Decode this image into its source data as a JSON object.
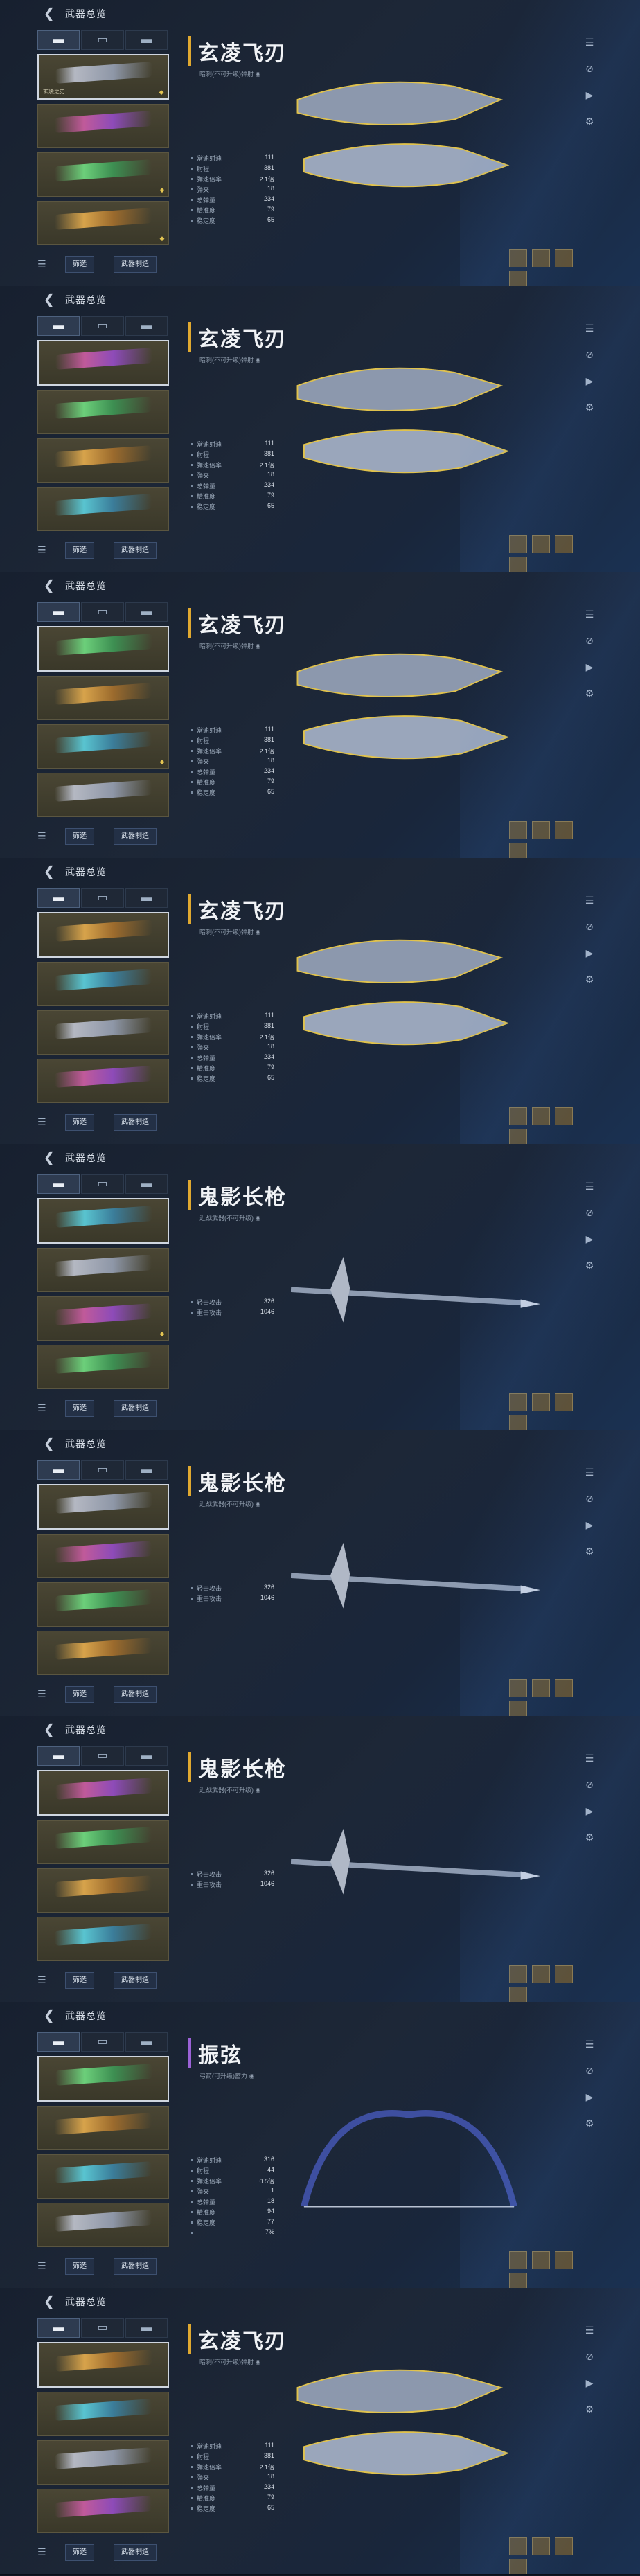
{
  "shared": {
    "nav_title": "武器总览",
    "filter_label": "筛选",
    "custom_label": "武器制造",
    "back_icon": "back-arrow-icon",
    "tool_icons": [
      "list-icon",
      "target-icon",
      "play-icon",
      "gear-icon"
    ]
  },
  "panels": [
    {
      "title": "玄凌飞刃",
      "subtitle": "暗刺(不可升级)弹射 ◉",
      "title_color": "#e0a930",
      "stats": [
        {
          "k": "常速射速",
          "v": "111"
        },
        {
          "k": "射程",
          "v": "381"
        },
        {
          "k": "弹速倍率",
          "v": "2.1倍"
        },
        {
          "k": "弹夹",
          "v": "18"
        },
        {
          "k": "总弹量",
          "v": "234"
        },
        {
          "k": "精准度",
          "v": "79"
        },
        {
          "k": "稳定度",
          "v": "65"
        }
      ],
      "items": [
        {
          "name": "玄凌之刃",
          "mark": "◆"
        },
        {
          "name": "",
          "mark": ""
        },
        {
          "name": "",
          "mark": "◆"
        },
        {
          "name": "",
          "mark": "◆"
        }
      ]
    },
    {
      "title": "玄凌飞刃",
      "subtitle": "暗刺(不可升级)弹射 ◉",
      "title_color": "#e0a930",
      "stats": [
        {
          "k": "常速射速",
          "v": "111"
        },
        {
          "k": "射程",
          "v": "381"
        },
        {
          "k": "弹速倍率",
          "v": "2.1倍"
        },
        {
          "k": "弹夹",
          "v": "18"
        },
        {
          "k": "总弹量",
          "v": "234"
        },
        {
          "k": "精准度",
          "v": "79"
        },
        {
          "k": "稳定度",
          "v": "65"
        }
      ],
      "items": [
        {
          "name": "",
          "mark": ""
        },
        {
          "name": "",
          "mark": ""
        },
        {
          "name": "",
          "mark": ""
        },
        {
          "name": "",
          "mark": ""
        }
      ]
    },
    {
      "title": "玄凌飞刃",
      "subtitle": "暗刺(不可升级)弹射 ◉",
      "title_color": "#e0a930",
      "stats": [
        {
          "k": "常速射速",
          "v": "111"
        },
        {
          "k": "射程",
          "v": "381"
        },
        {
          "k": "弹速倍率",
          "v": "2.1倍"
        },
        {
          "k": "弹夹",
          "v": "18"
        },
        {
          "k": "总弹量",
          "v": "234"
        },
        {
          "k": "精准度",
          "v": "79"
        },
        {
          "k": "稳定度",
          "v": "65"
        }
      ],
      "items": [
        {
          "name": "",
          "mark": ""
        },
        {
          "name": "",
          "mark": ""
        },
        {
          "name": "",
          "mark": "◆"
        },
        {
          "name": "",
          "mark": ""
        }
      ]
    },
    {
      "title": "玄凌飞刃",
      "subtitle": "暗刺(不可升级)弹射 ◉",
      "title_color": "#e0a930",
      "stats": [
        {
          "k": "常速射速",
          "v": "111"
        },
        {
          "k": "射程",
          "v": "381"
        },
        {
          "k": "弹速倍率",
          "v": "2.1倍"
        },
        {
          "k": "弹夹",
          "v": "18"
        },
        {
          "k": "总弹量",
          "v": "234"
        },
        {
          "k": "精准度",
          "v": "79"
        },
        {
          "k": "稳定度",
          "v": "65"
        }
      ],
      "items": [
        {
          "name": "",
          "mark": ""
        },
        {
          "name": "",
          "mark": ""
        },
        {
          "name": "",
          "mark": ""
        },
        {
          "name": "",
          "mark": ""
        }
      ]
    },
    {
      "title": "鬼影长枪",
      "subtitle": "近战武器(不可升级) ◉",
      "title_color": "#e0a930",
      "stats": [
        {
          "k": "轻击攻击",
          "v": "326"
        },
        {
          "k": "重击攻击",
          "v": "1046"
        }
      ],
      "items": [
        {
          "name": "",
          "mark": ""
        },
        {
          "name": "",
          "mark": ""
        },
        {
          "name": "",
          "mark": "◆"
        },
        {
          "name": "",
          "mark": ""
        }
      ]
    },
    {
      "title": "鬼影长枪",
      "subtitle": "近战武器(不可升级) ◉",
      "title_color": "#e0a930",
      "stats": [
        {
          "k": "轻击攻击",
          "v": "326"
        },
        {
          "k": "重击攻击",
          "v": "1046"
        }
      ],
      "items": [
        {
          "name": "",
          "mark": ""
        },
        {
          "name": "",
          "mark": ""
        },
        {
          "name": "",
          "mark": ""
        },
        {
          "name": "",
          "mark": ""
        }
      ]
    },
    {
      "title": "鬼影长枪",
      "subtitle": "近战武器(不可升级) ◉",
      "title_color": "#e0a930",
      "stats": [
        {
          "k": "轻击攻击",
          "v": "326"
        },
        {
          "k": "重击攻击",
          "v": "1046"
        }
      ],
      "items": [
        {
          "name": "",
          "mark": ""
        },
        {
          "name": "",
          "mark": ""
        },
        {
          "name": "",
          "mark": ""
        },
        {
          "name": "",
          "mark": ""
        }
      ]
    },
    {
      "title": "振弦",
      "subtitle": "弓箭(可升级)蓄力 ◉",
      "title_color": "#9b62d6",
      "stats": [
        {
          "k": "常速射速",
          "v": "316"
        },
        {
          "k": "射程",
          "v": "44"
        },
        {
          "k": "弹速倍率",
          "v": "0.5倍"
        },
        {
          "k": "弹夹",
          "v": "1"
        },
        {
          "k": "总弹量",
          "v": "18"
        },
        {
          "k": "精准度",
          "v": "94"
        },
        {
          "k": "稳定度",
          "v": "77"
        },
        {
          "k": "",
          "v": "7%"
        }
      ],
      "items": [
        {
          "name": "",
          "mark": ""
        },
        {
          "name": "",
          "mark": ""
        },
        {
          "name": "",
          "mark": ""
        },
        {
          "name": "",
          "mark": ""
        }
      ]
    },
    {
      "title": "玄凌飞刃",
      "subtitle": "暗刺(不可升级)弹射 ◉",
      "title_color": "#e0a930",
      "stats": [
        {
          "k": "常速射速",
          "v": "111"
        },
        {
          "k": "射程",
          "v": "381"
        },
        {
          "k": "弹速倍率",
          "v": "2.1倍"
        },
        {
          "k": "弹夹",
          "v": "18"
        },
        {
          "k": "总弹量",
          "v": "234"
        },
        {
          "k": "精准度",
          "v": "79"
        },
        {
          "k": "稳定度",
          "v": "65"
        }
      ],
      "items": [
        {
          "name": "",
          "mark": ""
        },
        {
          "name": "",
          "mark": ""
        },
        {
          "name": "",
          "mark": ""
        },
        {
          "name": "",
          "mark": ""
        }
      ]
    }
  ]
}
